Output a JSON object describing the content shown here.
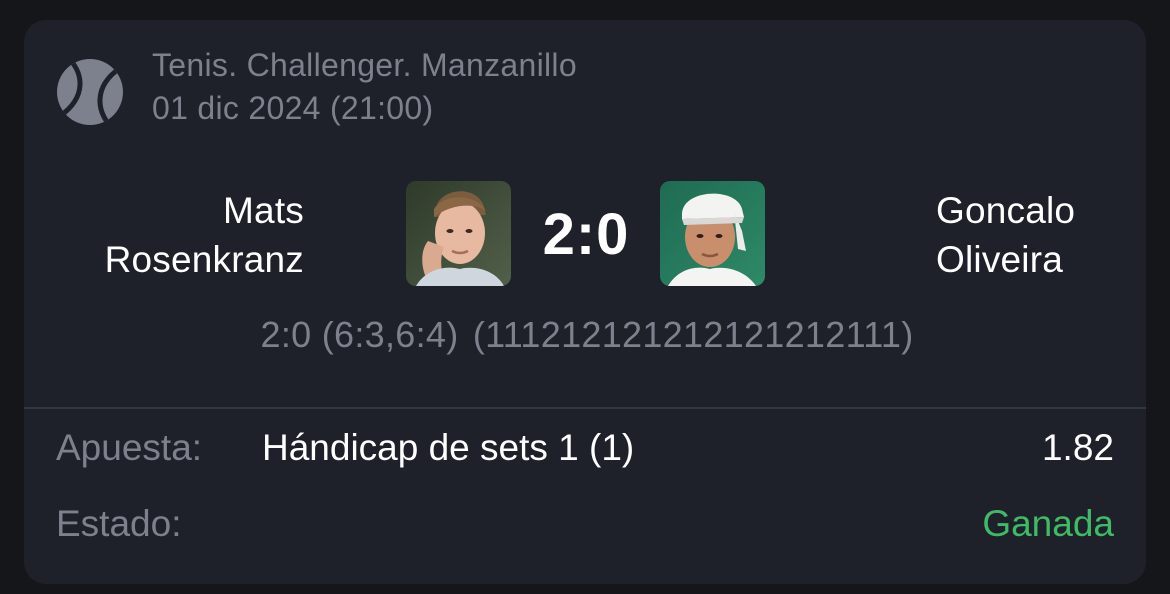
{
  "event": {
    "sport_icon": "tennis-ball-icon",
    "tournament": "Tenis. Challenger. Manzanillo",
    "datetime": "01 dic 2024 (21:00)"
  },
  "match": {
    "player1": {
      "first_name": "Mats",
      "last_name": "Rosenkranz",
      "avatar": "player-photo"
    },
    "player2": {
      "first_name": "Goncalo",
      "last_name": "Oliveira",
      "avatar": "player-photo"
    },
    "score": "2:0",
    "detail_score": "2:0 (6:3,6:4)",
    "points_sequence": "(111212121212121212111)"
  },
  "bet": {
    "label": "Apuesta:",
    "selection": "Hándicap de sets 1 (1)",
    "odds": "1.82"
  },
  "status": {
    "label": "Estado:",
    "value": "Ganada",
    "color": "#3fba66"
  },
  "colors": {
    "card_background": "#1e2129",
    "muted_text": "#7c818d",
    "primary_text": "#ffffff",
    "win_green": "#3fba66"
  }
}
